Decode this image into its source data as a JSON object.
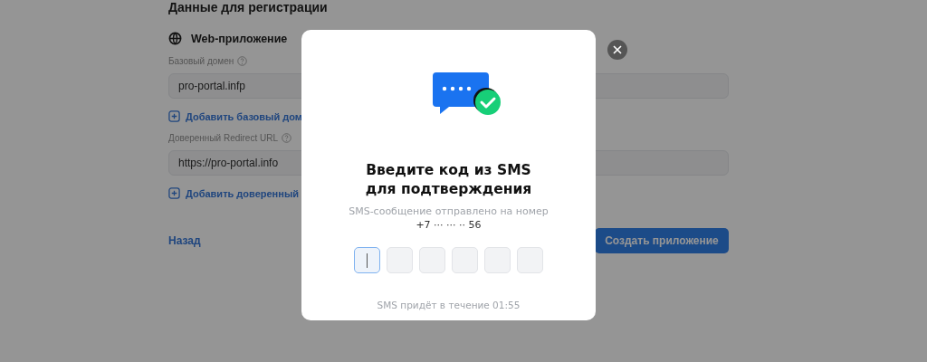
{
  "page": {
    "heading": "Данные для регистрации",
    "section_title": "Web-приложение",
    "fields": [
      {
        "label": "Базовый домен",
        "value": "pro-portal.infp",
        "add_link": "Добавить базовый дом"
      },
      {
        "label": "Доверенный Redirect URL",
        "value": "https://pro-portal.info",
        "add_link": "Добавить доверенный"
      }
    ],
    "back_link": "Назад",
    "create_button": "Создать приложение"
  },
  "dialog": {
    "title": "Введите код из SMS\nдля подтверждения",
    "subtitle": "SMS-сообщение отправлено на номер",
    "phone": "+7 ··· ··· ·· 56",
    "code_cells": [
      {
        "selected": true
      },
      {
        "selected": false
      },
      {
        "selected": false
      },
      {
        "selected": false
      },
      {
        "selected": false
      },
      {
        "selected": false
      }
    ],
    "timer_note": "SMS придёт в течение 01:55"
  }
}
